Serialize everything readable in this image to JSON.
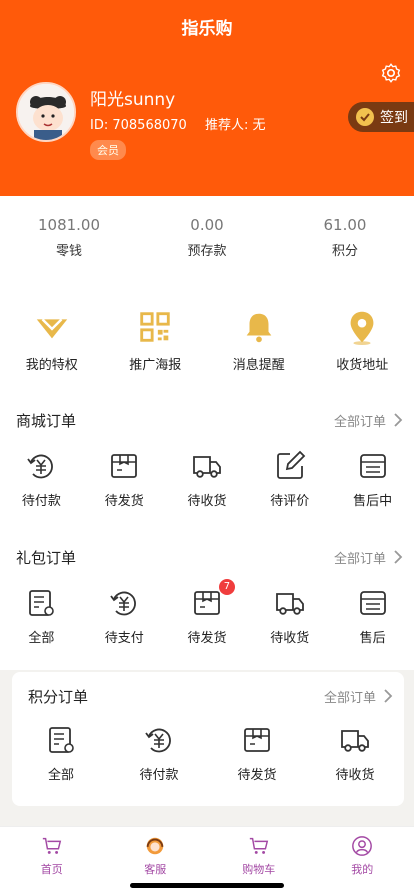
{
  "header": {
    "title": "指乐购"
  },
  "profile": {
    "name": "阳光sunny",
    "id_text": "ID: 708568070",
    "referrer_text": "推荐人: 无",
    "badge": "会员",
    "signin_label": "签到"
  },
  "stats": [
    {
      "value": "1081.00",
      "label": "零钱"
    },
    {
      "value": "0.00",
      "label": "预存款"
    },
    {
      "value": "61.00",
      "label": "积分"
    }
  ],
  "quick": [
    {
      "label": "我的特权",
      "icon": "diamond-icon"
    },
    {
      "label": "推广海报",
      "icon": "qr-code-icon"
    },
    {
      "label": "消息提醒",
      "icon": "bell-icon"
    },
    {
      "label": "收货地址",
      "icon": "location-pin-icon"
    }
  ],
  "mall_orders": {
    "title": "商城订单",
    "all": "全部订单",
    "items": [
      {
        "label": "待付款",
        "icon": "payment-icon"
      },
      {
        "label": "待发货",
        "icon": "package-icon"
      },
      {
        "label": "待收货",
        "icon": "truck-icon"
      },
      {
        "label": "待评价",
        "icon": "edit-icon"
      },
      {
        "label": "售后中",
        "icon": "after-sale-icon"
      }
    ]
  },
  "gift_orders": {
    "title": "礼包订单",
    "all": "全部订单",
    "items": [
      {
        "label": "全部",
        "icon": "list-icon"
      },
      {
        "label": "待支付",
        "icon": "payment-icon"
      },
      {
        "label": "待发货",
        "icon": "package-icon",
        "badge": "7"
      },
      {
        "label": "待收货",
        "icon": "truck-icon"
      },
      {
        "label": "售后",
        "icon": "after-sale-icon"
      }
    ]
  },
  "points_orders": {
    "title": "积分订单",
    "all": "全部订单",
    "items": [
      {
        "label": "全部",
        "icon": "list-icon"
      },
      {
        "label": "待付款",
        "icon": "payment-icon"
      },
      {
        "label": "待发货",
        "icon": "package-icon"
      },
      {
        "label": "待收货",
        "icon": "truck-icon"
      }
    ]
  },
  "tabbar": [
    {
      "label": "首页",
      "icon": "cart-icon"
    },
    {
      "label": "客服",
      "icon": "customer-service-icon"
    },
    {
      "label": "购物车",
      "icon": "cart-icon"
    },
    {
      "label": "我的",
      "icon": "user-icon"
    }
  ],
  "colors": {
    "brand": "#ff5a0a",
    "gold": "#f2c14e",
    "tab": "#a349a4",
    "badge": "#f03d3d"
  }
}
